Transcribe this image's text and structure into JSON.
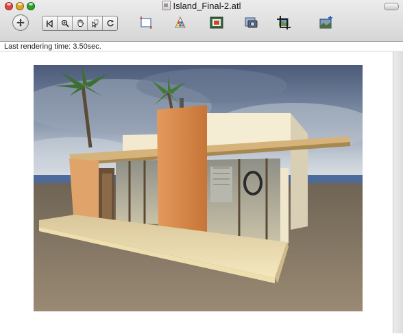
{
  "window": {
    "title": "Island_Final-2.atl"
  },
  "toolbar": {
    "buttons": [
      {
        "icon": "move-cross-icon",
        "label": ""
      },
      {
        "icon": "first-frame-icon",
        "label": ""
      },
      {
        "icon": "zoom-icon",
        "label": ""
      },
      {
        "icon": "hand-pan-icon",
        "label": ""
      },
      {
        "icon": "pointer-select-icon",
        "label": ""
      },
      {
        "icon": "rotate-icon",
        "label": ""
      },
      {
        "icon": "crop-frame-icon",
        "label": ""
      },
      {
        "icon": "color-palette-icon",
        "label": ""
      },
      {
        "icon": "render-image-icon",
        "label": ""
      },
      {
        "icon": "camera-snapshot-icon",
        "label": ""
      },
      {
        "icon": "crop-image-icon",
        "label": ""
      },
      {
        "icon": "add-image-icon",
        "label": ""
      }
    ]
  },
  "status": {
    "text": "Last rendering time: 3.50sec."
  },
  "colors": {
    "sky": "#7a8aa2",
    "sand": "#8a7a66",
    "wall_orange": "#d98e4e",
    "deck": "#f1e2b5",
    "sea": "#4c6a9a"
  }
}
